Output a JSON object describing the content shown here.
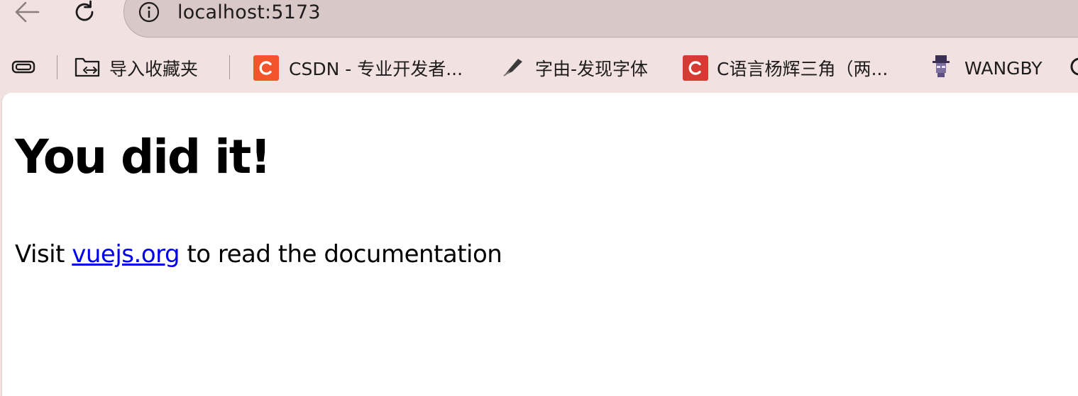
{
  "browser": {
    "url": "localhost:5173",
    "icons": {
      "back": "back-arrow-icon",
      "reload": "reload-icon",
      "site_info": "info-icon"
    }
  },
  "bookmarks": {
    "items": [
      {
        "label": "",
        "icon": "tab-groups-icon"
      },
      {
        "label": "导入收藏夹",
        "icon": "import-folder-icon"
      },
      {
        "label": "CSDN - 专业开发者...",
        "icon": "csdn-logo-icon",
        "icon_color": "#f4542c"
      },
      {
        "label": "字由-发现字体",
        "icon": "pen-nib-icon"
      },
      {
        "label": "C语言杨辉三角（两...",
        "icon": "csdn-logo-icon",
        "icon_color": "#d73a32"
      },
      {
        "label": "WANGBY",
        "icon": "wangby-avatar-icon"
      }
    ]
  },
  "page": {
    "heading": "You did it!",
    "paragraph": {
      "before": "Visit ",
      "link": "vuejs.org",
      "after": " to read the documentation"
    }
  },
  "colors": {
    "chrome_background": "#f1e2e1",
    "omnibox": "#d8c9c8",
    "link": "#0000ee"
  }
}
